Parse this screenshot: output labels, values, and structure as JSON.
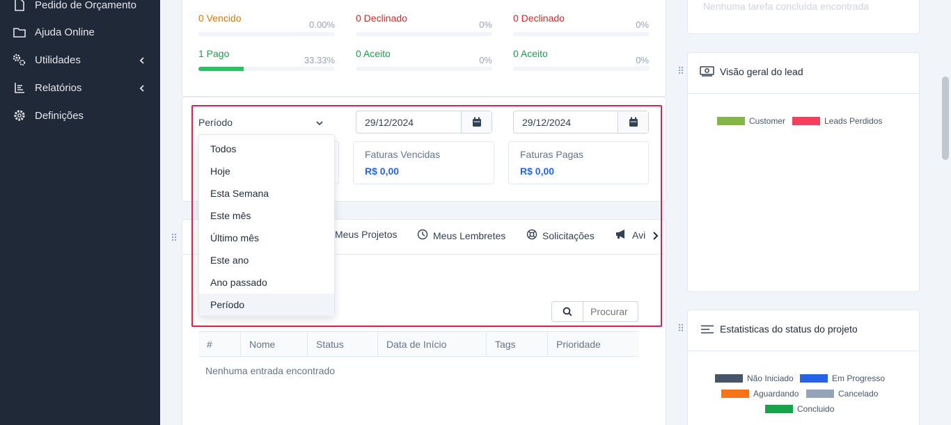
{
  "sidebar": {
    "items": [
      {
        "label": "Pedido de Orçamento",
        "icon": "file-icon"
      },
      {
        "label": "Ajuda Online",
        "icon": "folder-icon"
      },
      {
        "label": "Utilidades",
        "icon": "cogs-icon"
      },
      {
        "label": "Relatórios",
        "icon": "list-icon"
      },
      {
        "label": "Definições",
        "icon": "gear-icon"
      }
    ]
  },
  "stats": {
    "col1": [
      {
        "label": "0 Vencido",
        "pct": "0.00%",
        "progress": 0
      },
      {
        "label": "1 Pago",
        "pct": "33.33%",
        "progress": 0.3333
      }
    ],
    "col2": [
      {
        "label": "0 Declinado",
        "pct": "0%",
        "progress": 0
      },
      {
        "label": "0 Aceito",
        "pct": "0%",
        "progress": 0
      }
    ],
    "col3": [
      {
        "label": "0 Declinado",
        "pct": "0%",
        "progress": 0
      },
      {
        "label": "0 Aceito",
        "pct": "0%",
        "progress": 0
      }
    ]
  },
  "filter": {
    "period_value": "Período",
    "date_from": "29/12/2024",
    "date_to": "29/12/2024",
    "options": [
      "Todos",
      "Hoje",
      "Esta Semana",
      "Este mês",
      "Último mês",
      "Este ano",
      "Ano passado",
      "Período"
    ],
    "active_option": "Período"
  },
  "invoice_cards": [
    {
      "title": "Faturas Vencidas",
      "value": "R$ 0,00"
    },
    {
      "title": "Faturas Pagas",
      "value": "R$ 0,00"
    }
  ],
  "tabs": [
    {
      "label": "Meus Projetos"
    },
    {
      "label": "Meus Lembretes"
    },
    {
      "label": "Solicitações"
    },
    {
      "label": "Avi"
    }
  ],
  "search": {
    "placeholder": "Procurar"
  },
  "table": {
    "headers": [
      "#",
      "Nome",
      "Status",
      "Data de Início",
      "Tags",
      "Prioridade"
    ],
    "empty": "Nenhuma entrada encontrado"
  },
  "right": {
    "tasks_empty": "Nenhuma tarefa concluída encontrada",
    "lead_title": "Visão geral do lead",
    "lead_legend": [
      {
        "name": "Customer",
        "color": "#84b547"
      },
      {
        "name": "Leads Perdidos",
        "color": "#f43f5e"
      }
    ],
    "project_title": "Estatisticas do status do projeto",
    "project_legend": [
      {
        "name": "Não Iniciado",
        "color": "#475569"
      },
      {
        "name": "Em Progresso",
        "color": "#2563eb"
      },
      {
        "name": "Aguardando",
        "color": "#f97316"
      },
      {
        "name": "Cancelado",
        "color": "#94a3b8"
      },
      {
        "name": "Concluido",
        "color": "#16a34a"
      }
    ]
  }
}
